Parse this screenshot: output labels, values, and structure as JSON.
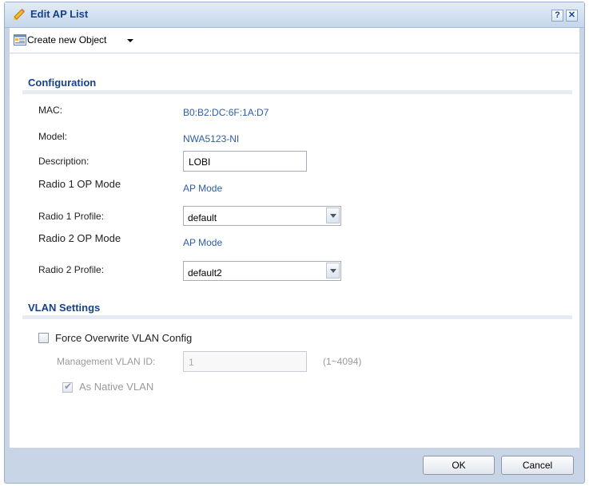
{
  "dialog": {
    "title": "Edit AP List",
    "help_label": "?",
    "close_label": "✕"
  },
  "toolbar": {
    "create_label": "Create new Object"
  },
  "configuration": {
    "title": "Configuration",
    "mac_label": "MAC:",
    "mac_value": "B0:B2:DC:6F:1A:D7",
    "model_label": "Model:",
    "model_value": "NWA5123-NI",
    "description_label": "Description:",
    "description_value": "LOBI",
    "radio1_mode_label": "Radio 1 OP Mode",
    "radio1_mode_value": "AP Mode",
    "radio1_profile_label": "Radio 1 Profile:",
    "radio1_profile_value": "default",
    "radio2_mode_label": "Radio 2 OP Mode",
    "radio2_mode_value": "AP Mode",
    "radio2_profile_label": "Radio 2 Profile:",
    "radio2_profile_value": "default2"
  },
  "vlan": {
    "title": "VLAN Settings",
    "force_overwrite_label": "Force Overwrite VLAN Config",
    "force_overwrite_checked": false,
    "mgmt_vlan_label": "Management VLAN ID:",
    "mgmt_vlan_value": "1",
    "mgmt_vlan_range": "(1~4094)",
    "native_vlan_label": "As Native VLAN",
    "native_vlan_checked": true
  },
  "footer": {
    "ok_label": "OK",
    "cancel_label": "Cancel"
  }
}
